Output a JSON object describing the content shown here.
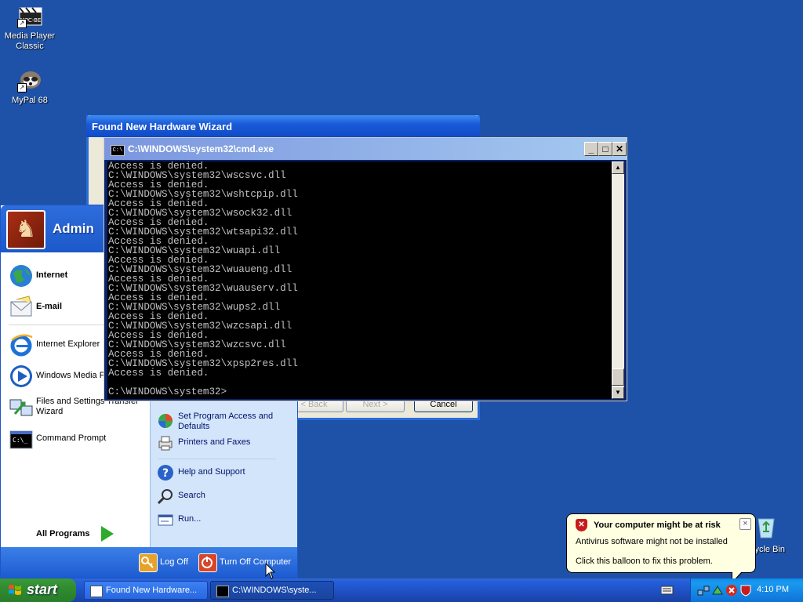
{
  "desktop": {
    "icons": [
      {
        "label_line1": "Media Player",
        "label_line2": "Classic",
        "icon": "media-player-classic-icon",
        "badge": "MPC-BE"
      },
      {
        "label_line1": "MyPal 68",
        "label_line2": "",
        "icon": "mypal-raccoon-icon"
      }
    ],
    "recycle_bin_label": "ycle Bin"
  },
  "wizard": {
    "title": "Found New Hardware Wizard",
    "back_label": "< Back",
    "next_label": "Next >",
    "cancel_label": "Cancel"
  },
  "cmd": {
    "title": "C:\\WINDOWS\\system32\\cmd.exe",
    "icon_text": "C:\\",
    "minimize": "_",
    "maximize": "□",
    "close": "✕",
    "lines": [
      "Access is denied.",
      "C:\\WINDOWS\\system32\\wscsvc.dll",
      "Access is denied.",
      "C:\\WINDOWS\\system32\\wshtcpip.dll",
      "Access is denied.",
      "C:\\WINDOWS\\system32\\wsock32.dll",
      "Access is denied.",
      "C:\\WINDOWS\\system32\\wtsapi32.dll",
      "Access is denied.",
      "C:\\WINDOWS\\system32\\wuapi.dll",
      "Access is denied.",
      "C:\\WINDOWS\\system32\\wuaueng.dll",
      "Access is denied.",
      "C:\\WINDOWS\\system32\\wuauserv.dll",
      "Access is denied.",
      "C:\\WINDOWS\\system32\\wups2.dll",
      "Access is denied.",
      "C:\\WINDOWS\\system32\\wzcsapi.dll",
      "Access is denied.",
      "C:\\WINDOWS\\system32\\wzcsvc.dll",
      "Access is denied.",
      "C:\\WINDOWS\\system32\\xpsp2res.dll",
      "Access is denied.",
      "",
      "C:\\WINDOWS\\system32>"
    ]
  },
  "start_menu": {
    "user": "Admin",
    "pinned": [
      {
        "label": "Internet",
        "icon": "internet-globe-icon"
      },
      {
        "label": "E-mail",
        "icon": "email-envelope-icon"
      }
    ],
    "recent": [
      {
        "label": "Internet Explorer",
        "icon": "internet-explorer-icon"
      },
      {
        "label": "Windows Media Pl",
        "icon": "windows-media-player-icon"
      },
      {
        "label_line1": "Files and Settings Transfer",
        "label_line2": "Wizard",
        "icon": "files-settings-transfer-icon"
      },
      {
        "label": "Command Prompt",
        "icon": "command-prompt-icon"
      }
    ],
    "all_programs": "All Programs",
    "right": [
      {
        "label_line1": "Set Program Access and",
        "label_line2": "Defaults",
        "icon": "program-access-icon"
      },
      {
        "label": "Printers and Faxes",
        "icon": "printer-icon"
      },
      {
        "label": "Help and Support",
        "icon": "help-icon"
      },
      {
        "label": "Search",
        "icon": "search-icon"
      },
      {
        "label": "Run...",
        "icon": "run-icon"
      }
    ],
    "log_off": "Log Off",
    "turn_off": "Turn Off Computer"
  },
  "balloon": {
    "title": "Your computer might be at risk",
    "line1": "Antivirus software might not be installed",
    "line2": "Click this balloon to fix this problem.",
    "close": "×"
  },
  "taskbar": {
    "start": "start",
    "tasks": [
      {
        "label": "Found New Hardware...",
        "active": false
      },
      {
        "label": "C:\\WINDOWS\\syste...",
        "active": true
      }
    ],
    "clock": "4:10 PM"
  },
  "colors": {
    "desktop": "#1e52a8",
    "start_green": "#2f8c2f",
    "title_blue": "#1a5ad6",
    "alert_red": "#c81b1b"
  }
}
